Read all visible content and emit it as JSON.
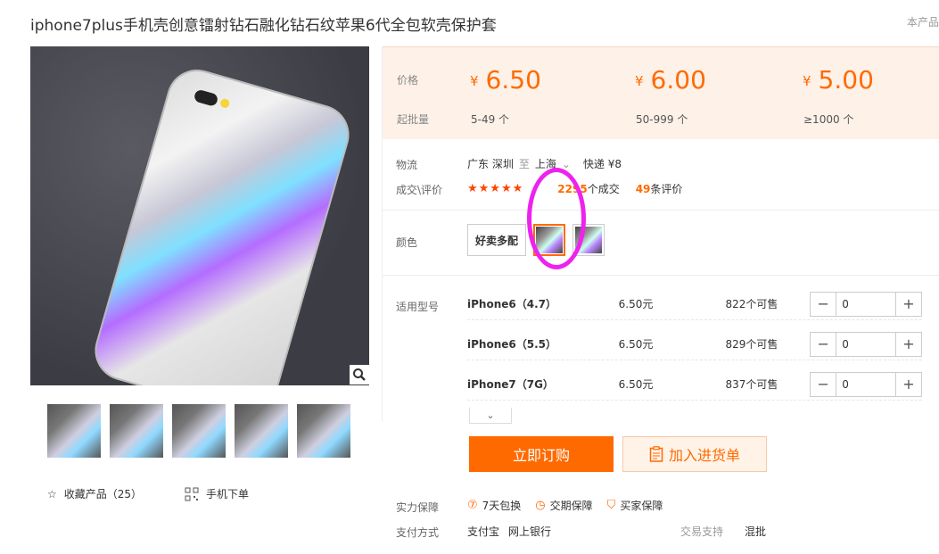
{
  "product": {
    "title": "iphone7plus手机壳创意镭射钻石融化钻石纹苹果6代全包软壳保护套",
    "corner_text": "本产品"
  },
  "favorites": {
    "label": "收藏产品（25）"
  },
  "mobile_order": {
    "label": "手机下单"
  },
  "pricing": {
    "price_label": "价格",
    "batch_label": "起批量",
    "currency": "¥",
    "tiers": [
      {
        "price": "6.50",
        "qty": "5-49 个"
      },
      {
        "price": "6.00",
        "qty": "50-999 个"
      },
      {
        "price": "5.00",
        "qty": "≥1000 个"
      }
    ]
  },
  "logistics": {
    "label": "物流",
    "from": "广东 深圳",
    "to_word": "至",
    "to": "上海",
    "shipping": "快递 ¥8"
  },
  "deals": {
    "label": "成交\\评价",
    "stars": "★★★★★",
    "deal_count_visible": "2295",
    "deal_suffix": "个成交",
    "review_count": "49",
    "review_suffix": "条评价"
  },
  "colors": {
    "label": "颜色",
    "options": [
      "好卖多配"
    ]
  },
  "models": {
    "label": "适用型号",
    "rows": [
      {
        "name": "iPhone6（4.7）",
        "price": "6.50元",
        "stock": "822个可售",
        "qty": "0"
      },
      {
        "name": "iPhone6（5.5）",
        "price": "6.50元",
        "stock": "829个可售",
        "qty": "0"
      },
      {
        "name": "iPhone7（7G）",
        "price": "6.50元",
        "stock": "837个可售",
        "qty": "0"
      }
    ]
  },
  "actions": {
    "buy_now": "立即订购",
    "add_cart": "加入进货单"
  },
  "guarantee": {
    "label": "实力保障",
    "items": [
      "7天包换",
      "交期保障",
      "买家保障"
    ]
  },
  "payment": {
    "label": "支付方式",
    "methods": [
      "支付宝",
      "网上银行"
    ],
    "trade_label": "交易支持",
    "trade_value": "混批"
  },
  "colors_theme": {
    "accent": "#ff6a00",
    "panel_bg": "#fdf1e8",
    "annotation": "#ee22ee"
  }
}
